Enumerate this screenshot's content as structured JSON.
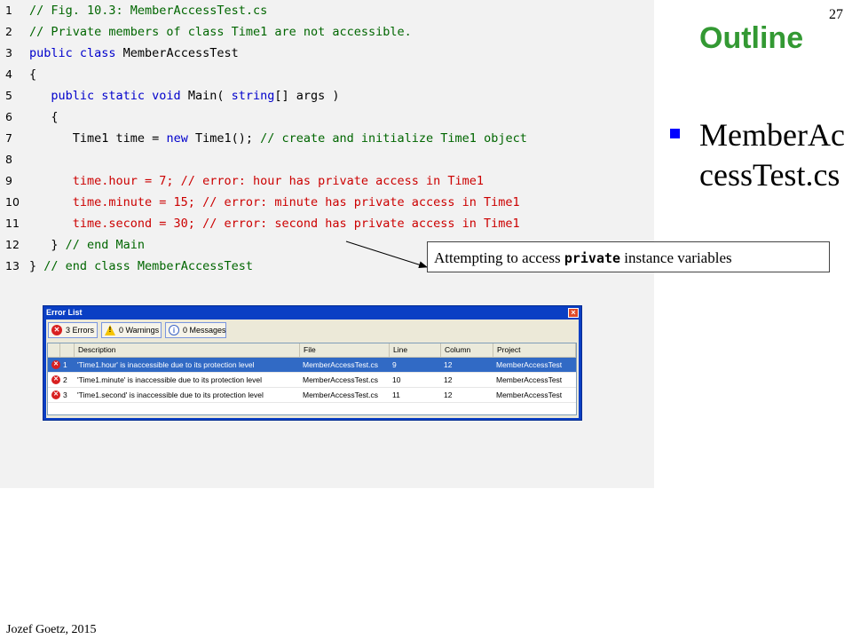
{
  "page_number": "27",
  "outline": {
    "title": "Outline",
    "bullet": "MemberAccessTest.cs"
  },
  "code_lines": [
    {
      "n": "1",
      "parts": [
        {
          "c": "cm",
          "t": "// Fig. 10.3: MemberAccessTest.cs"
        }
      ]
    },
    {
      "n": "2",
      "parts": [
        {
          "c": "cm",
          "t": "// Private members of class Time1 are not accessible."
        }
      ]
    },
    {
      "n": "3",
      "parts": [
        {
          "c": "kw",
          "t": "public class "
        },
        {
          "c": "tx",
          "t": "MemberAccessTest"
        }
      ]
    },
    {
      "n": "4",
      "parts": [
        {
          "c": "tx",
          "t": "{"
        }
      ]
    },
    {
      "n": "5",
      "parts": [
        {
          "c": "tx",
          "t": "   "
        },
        {
          "c": "kw",
          "t": "public static void "
        },
        {
          "c": "tx",
          "t": "Main( "
        },
        {
          "c": "kw",
          "t": "string"
        },
        {
          "c": "tx",
          "t": "[] args )"
        }
      ]
    },
    {
      "n": "6",
      "parts": [
        {
          "c": "tx",
          "t": "   {"
        }
      ]
    },
    {
      "n": "7",
      "parts": [
        {
          "c": "tx",
          "t": "      Time1 time = "
        },
        {
          "c": "kw",
          "t": "new "
        },
        {
          "c": "tx",
          "t": "Time1(); "
        },
        {
          "c": "cm",
          "t": "// create and initialize Time1 object"
        }
      ]
    },
    {
      "n": "8",
      "parts": []
    },
    {
      "n": "9",
      "parts": [
        {
          "c": "er",
          "t": "      time.hour = 7; // error: hour has private access in Time1"
        }
      ]
    },
    {
      "n": "10",
      "parts": [
        {
          "c": "er",
          "t": "      time.minute = 15; // error: minute has private access in Time1"
        }
      ]
    },
    {
      "n": "11",
      "parts": [
        {
          "c": "er",
          "t": "      time.second = 30; // error: second has private access in Time1"
        }
      ]
    },
    {
      "n": "12",
      "parts": [
        {
          "c": "tx",
          "t": "   } "
        },
        {
          "c": "cm",
          "t": "// end Main"
        }
      ]
    },
    {
      "n": "13",
      "parts": [
        {
          "c": "tx",
          "t": "} "
        },
        {
          "c": "cm",
          "t": "// end class MemberAccessTest"
        }
      ]
    }
  ],
  "callout": {
    "prefix": "Attempting to access ",
    "keyword": "private",
    "suffix": " instance variables"
  },
  "error_list": {
    "title": "Error List",
    "errors_btn": "3 Errors",
    "warnings_btn": "0 Warnings",
    "messages_btn": "0 Messages",
    "columns": [
      "Description",
      "File",
      "Line",
      "Column",
      "Project"
    ],
    "rows": [
      {
        "num": "1",
        "description": "'Time1.hour' is inaccessible due to its protection level",
        "file": "MemberAccessTest.cs",
        "line": "9",
        "column": "12",
        "project": "MemberAccessTest"
      },
      {
        "num": "2",
        "description": "'Time1.minute' is inaccessible due to its protection level",
        "file": "MemberAccessTest.cs",
        "line": "10",
        "column": "12",
        "project": "MemberAccessTest"
      },
      {
        "num": "3",
        "description": "'Time1.second' is inaccessible due to its protection level",
        "file": "MemberAccessTest.cs",
        "line": "11",
        "column": "12",
        "project": "MemberAccessTest"
      }
    ]
  },
  "footer": "Jozef Goetz, 2015",
  "colors": {
    "outline_green": "#339933",
    "comment_green": "#006600",
    "keyword_blue": "#0000cc",
    "error_red": "#cc0000"
  }
}
